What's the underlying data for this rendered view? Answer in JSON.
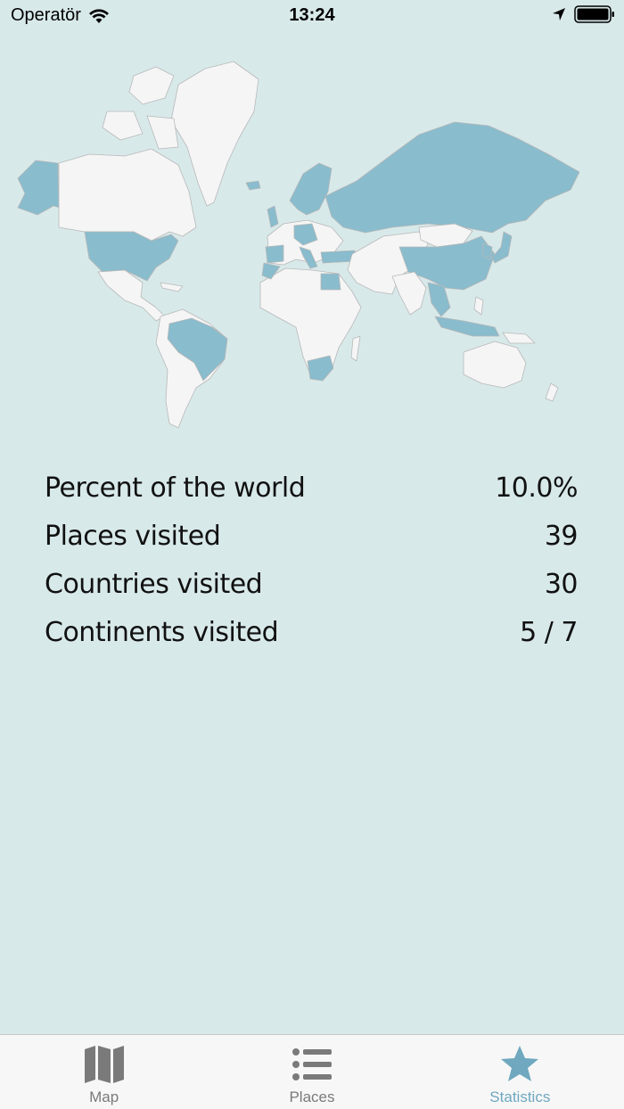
{
  "status_bar": {
    "carrier": "Operatör",
    "time": "13:24"
  },
  "colors": {
    "background": "#d8e9ea",
    "visited_country": "#89bccd",
    "unvisited_country": "#f5f5f5",
    "active_tab": "#6fa8bf",
    "inactive_tab": "#7a7a7a"
  },
  "stats": [
    {
      "label": "Percent of the world",
      "value": "10.0%"
    },
    {
      "label": "Places visited",
      "value": "39"
    },
    {
      "label": "Countries visited",
      "value": "30"
    },
    {
      "label": "Continents visited",
      "value": "5 / 7"
    }
  ],
  "tabs": [
    {
      "label": "Map",
      "icon": "map-icon",
      "active": false
    },
    {
      "label": "Places",
      "icon": "list-icon",
      "active": false
    },
    {
      "label": "Statistics",
      "icon": "star-icon",
      "active": true
    }
  ]
}
